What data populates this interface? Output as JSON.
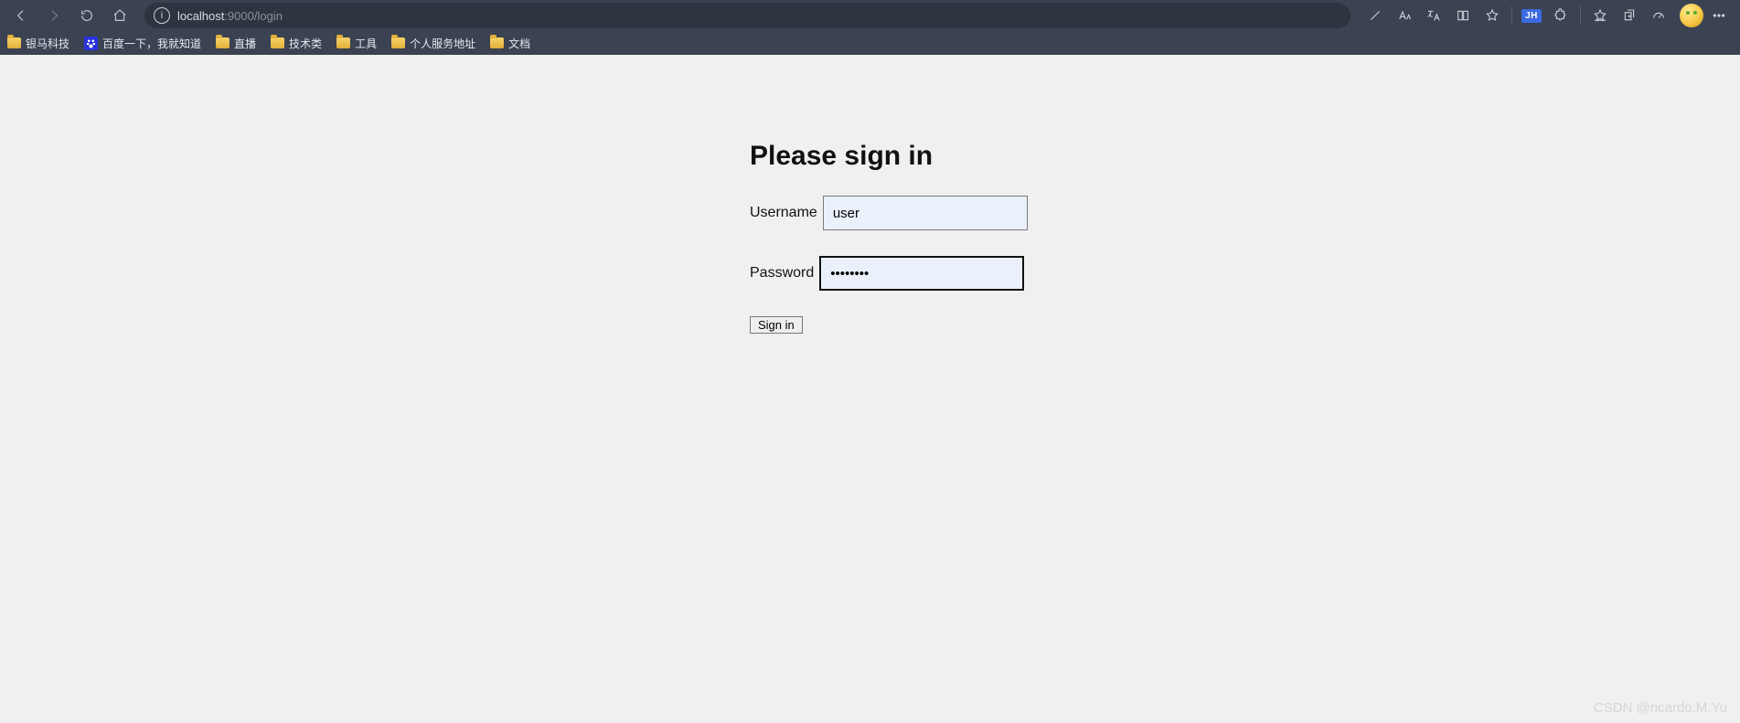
{
  "browser": {
    "url_host": "localhost",
    "url_rest": ":9000/login",
    "ext_badge": "JH"
  },
  "bookmarks": [
    {
      "icon": "folder",
      "label": "银马科技"
    },
    {
      "icon": "baidu",
      "label": "百度一下，我就知道"
    },
    {
      "icon": "folder",
      "label": "直播"
    },
    {
      "icon": "folder",
      "label": "技术类"
    },
    {
      "icon": "folder",
      "label": "工具"
    },
    {
      "icon": "folder",
      "label": "个人服务地址"
    },
    {
      "icon": "folder",
      "label": "文档"
    }
  ],
  "login": {
    "title": "Please sign in",
    "username_label": "Username",
    "username_value": "user",
    "password_label": "Password",
    "password_value": "••••••••",
    "submit_label": "Sign in"
  },
  "watermark": "CSDN @ricardo.M.Yu"
}
